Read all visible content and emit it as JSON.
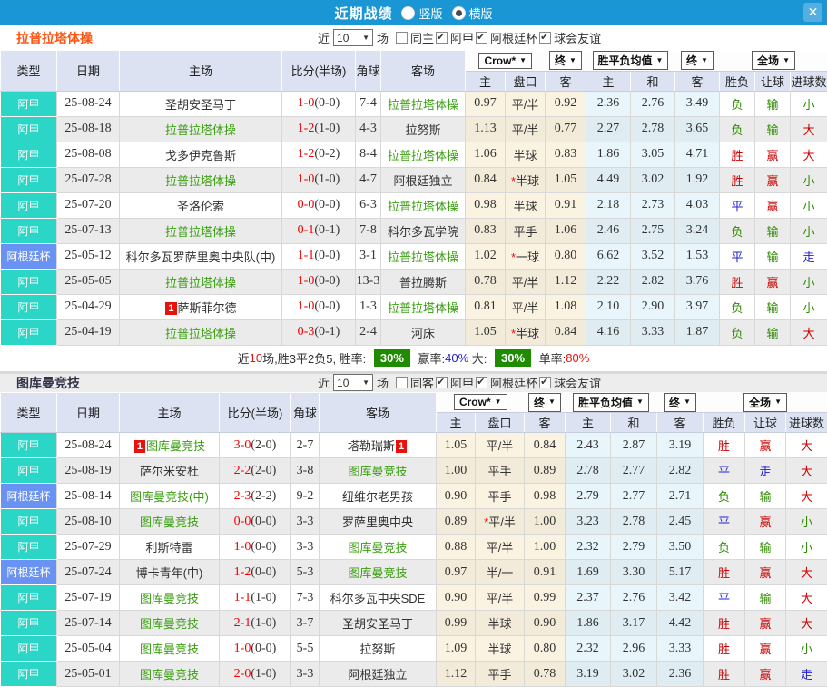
{
  "titlebar": {
    "title": "近期战绩",
    "vertical_label": "竖版",
    "vertical_checked": false,
    "horizontal_label": "横版",
    "horizontal_checked": true,
    "close_glyph": "✕"
  },
  "glyphs": {
    "down_arrow": "▼"
  },
  "colors": {
    "titlebar_bg": "#1b96d5",
    "section1_title": "#ff5412",
    "section2_title": "#323248",
    "league_badge_bg": "#2bd6c6",
    "cup_badge_bg": "#6a92f2",
    "self_team_green": "#3aa010",
    "score_red": "#f00000",
    "win_red": "#cc0000",
    "draw_blue": "#2222cc",
    "lose_green": "#2f8a00",
    "rate_badge_green": "#1f8c00"
  },
  "sections": [
    {
      "team": "拉普拉塔体操",
      "filter": {
        "near_label": "近",
        "games_value": "10",
        "games_suffix": "场",
        "same_label": "同主",
        "same_checked": false,
        "leagues": [
          {
            "label": "阿甲",
            "checked": true
          },
          {
            "label": "阿根廷杯",
            "checked": true
          },
          {
            "label": "球会友谊",
            "checked": true
          }
        ]
      },
      "header": {
        "type": "类型",
        "date": "日期",
        "home": "主场",
        "score": "比分(半场)",
        "corner": "角球",
        "away": "客场",
        "company_dd": "Crow*",
        "final_dd": "终",
        "avg_dd": "胜平负均值",
        "final_dd2": "终",
        "full_dd": "全场",
        "sub": {
          "home": "主",
          "handicap": "盘口",
          "away": "客",
          "avg_home": "主",
          "avg_draw": "和",
          "avg_away": "客",
          "wdl": "胜负",
          "hcap": "让球",
          "goals": "进球数"
        }
      },
      "rows": [
        {
          "type": "阿甲",
          "kind": "league",
          "date": "25-08-24",
          "home": "圣胡安圣马丁",
          "home_self": false,
          "home_badge": "",
          "score": "1-0",
          "half": "(0-0)",
          "corner": "7-4",
          "away": "拉普拉塔体操",
          "away_self": true,
          "away_badge": "",
          "o1": "0.97",
          "hcap": "平/半",
          "o2": "0.92",
          "a1": "2.36",
          "a2": "2.76",
          "a3": "3.49",
          "wdl": "负",
          "hres": "输",
          "goals": "小"
        },
        {
          "type": "阿甲",
          "kind": "league",
          "date": "25-08-18",
          "home": "拉普拉塔体操",
          "home_self": true,
          "home_badge": "",
          "score": "1-2",
          "half": "(1-0)",
          "corner": "4-3",
          "away": "拉努斯",
          "away_self": false,
          "away_badge": "",
          "o1": "1.13",
          "hcap": "平/半",
          "o2": "0.77",
          "a1": "2.27",
          "a2": "2.78",
          "a3": "3.65",
          "wdl": "负",
          "hres": "输",
          "goals": "大"
        },
        {
          "type": "阿甲",
          "kind": "league",
          "date": "25-08-08",
          "home": "戈多伊克鲁斯",
          "home_self": false,
          "home_badge": "",
          "score": "1-2",
          "half": "(0-2)",
          "corner": "8-4",
          "away": "拉普拉塔体操",
          "away_self": true,
          "away_badge": "",
          "o1": "1.06",
          "hcap": "半球",
          "o2": "0.83",
          "a1": "1.86",
          "a2": "3.05",
          "a3": "4.71",
          "wdl": "胜",
          "hres": "赢",
          "goals": "大"
        },
        {
          "type": "阿甲",
          "kind": "league",
          "date": "25-07-28",
          "home": "拉普拉塔体操",
          "home_self": true,
          "home_badge": "",
          "score": "1-0",
          "half": "(1-0)",
          "corner": "4-7",
          "away": "阿根廷独立",
          "away_self": false,
          "away_badge": "",
          "o1": "0.84",
          "hcap": "*半球",
          "o2": "1.05",
          "a1": "4.49",
          "a2": "3.02",
          "a3": "1.92",
          "wdl": "胜",
          "hres": "赢",
          "goals": "小"
        },
        {
          "type": "阿甲",
          "kind": "league",
          "date": "25-07-20",
          "home": "圣洛伦索",
          "home_self": false,
          "home_badge": "",
          "score": "0-0",
          "half": "(0-0)",
          "corner": "6-3",
          "away": "拉普拉塔体操",
          "away_self": true,
          "away_badge": "",
          "o1": "0.98",
          "hcap": "半球",
          "o2": "0.91",
          "a1": "2.18",
          "a2": "2.73",
          "a3": "4.03",
          "wdl": "平",
          "hres": "赢",
          "goals": "小"
        },
        {
          "type": "阿甲",
          "kind": "league",
          "date": "25-07-13",
          "home": "拉普拉塔体操",
          "home_self": true,
          "home_badge": "",
          "score": "0-1",
          "half": "(0-1)",
          "corner": "7-8",
          "away": "科尔多瓦学院",
          "away_self": false,
          "away_badge": "",
          "o1": "0.83",
          "hcap": "平手",
          "o2": "1.06",
          "a1": "2.46",
          "a2": "2.75",
          "a3": "3.24",
          "wdl": "负",
          "hres": "输",
          "goals": "小"
        },
        {
          "type": "阿根廷杯",
          "kind": "cup",
          "date": "25-05-12",
          "home": "科尔多瓦罗萨里奥中央队(中)",
          "home_self": false,
          "home_badge": "",
          "score": "1-1",
          "half": "(0-0)",
          "corner": "3-1",
          "away": "拉普拉塔体操",
          "away_self": true,
          "away_badge": "",
          "o1": "1.02",
          "hcap": "*一球",
          "o2": "0.80",
          "a1": "6.62",
          "a2": "3.52",
          "a3": "1.53",
          "wdl": "平",
          "hres": "输",
          "goals": "走"
        },
        {
          "type": "阿甲",
          "kind": "league",
          "date": "25-05-05",
          "home": "拉普拉塔体操",
          "home_self": true,
          "home_badge": "",
          "score": "1-0",
          "half": "(0-0)",
          "corner": "13-3",
          "away": "普拉腾斯",
          "away_self": false,
          "away_badge": "",
          "o1": "0.78",
          "hcap": "平/半",
          "o2": "1.12",
          "a1": "2.22",
          "a2": "2.82",
          "a3": "3.76",
          "wdl": "胜",
          "hres": "赢",
          "goals": "小"
        },
        {
          "type": "阿甲",
          "kind": "league",
          "date": "25-04-29",
          "home": "萨斯菲尔德",
          "home_self": false,
          "home_badge": "1",
          "score": "1-0",
          "half": "(0-0)",
          "corner": "1-3",
          "away": "拉普拉塔体操",
          "away_self": true,
          "away_badge": "",
          "o1": "0.81",
          "hcap": "平/半",
          "o2": "1.08",
          "a1": "2.10",
          "a2": "2.90",
          "a3": "3.97",
          "wdl": "负",
          "hres": "输",
          "goals": "小"
        },
        {
          "type": "阿甲",
          "kind": "league",
          "date": "25-04-19",
          "home": "拉普拉塔体操",
          "home_self": true,
          "home_badge": "",
          "score": "0-3",
          "half": "(0-1)",
          "corner": "2-4",
          "away": "河床",
          "away_self": false,
          "away_badge": "",
          "o1": "1.05",
          "hcap": "*半球",
          "o2": "0.84",
          "a1": "4.16",
          "a2": "3.33",
          "a3": "1.87",
          "wdl": "负",
          "hres": "输",
          "goals": "大"
        }
      ],
      "summary": [
        {
          "t": "近",
          "c": "k"
        },
        {
          "t": "10",
          "c": "r"
        },
        {
          "t": "场,胜3平2负5, 胜率: ",
          "c": "k"
        },
        {
          "t": "30%",
          "c": "G"
        },
        {
          "t": " 赢率:",
          "c": "k"
        },
        {
          "t": "40%",
          "c": "b"
        },
        {
          "t": " 大: ",
          "c": "k"
        },
        {
          "t": "30%",
          "c": "G"
        },
        {
          "t": " 单率:",
          "c": "k"
        },
        {
          "t": "80%",
          "c": "r"
        }
      ]
    },
    {
      "team": "图库曼竞技",
      "filter": {
        "near_label": "近",
        "games_value": "10",
        "games_suffix": "场",
        "same_label": "同客",
        "same_checked": false,
        "leagues": [
          {
            "label": "阿甲",
            "checked": true
          },
          {
            "label": "阿根廷杯",
            "checked": true
          },
          {
            "label": "球会友谊",
            "checked": true
          }
        ]
      },
      "header": {
        "type": "类型",
        "date": "日期",
        "home": "主场",
        "score": "比分(半场)",
        "corner": "角球",
        "away": "客场",
        "company_dd": "Crow*",
        "final_dd": "终",
        "avg_dd": "胜平负均值",
        "final_dd2": "终",
        "full_dd": "全场",
        "sub": {
          "home": "主",
          "handicap": "盘口",
          "away": "客",
          "avg_home": "主",
          "avg_draw": "和",
          "avg_away": "客",
          "wdl": "胜负",
          "hcap": "让球",
          "goals": "进球数"
        }
      },
      "rows": [
        {
          "type": "阿甲",
          "kind": "league",
          "date": "25-08-24",
          "home": "图库曼竞技",
          "home_self": true,
          "home_badge": "1",
          "score": "3-0",
          "half": "(2-0)",
          "corner": "2-7",
          "away": "塔勒瑞斯",
          "away_self": false,
          "away_badge": "1",
          "o1": "1.05",
          "hcap": "平/半",
          "o2": "0.84",
          "a1": "2.43",
          "a2": "2.87",
          "a3": "3.19",
          "wdl": "胜",
          "hres": "赢",
          "goals": "大"
        },
        {
          "type": "阿甲",
          "kind": "league",
          "date": "25-08-19",
          "home": "萨尔米安杜",
          "home_self": false,
          "home_badge": "",
          "score": "2-2",
          "half": "(2-0)",
          "corner": "3-8",
          "away": "图库曼竞技",
          "away_self": true,
          "away_badge": "",
          "o1": "1.00",
          "hcap": "平手",
          "o2": "0.89",
          "a1": "2.78",
          "a2": "2.77",
          "a3": "2.82",
          "wdl": "平",
          "hres": "走",
          "goals": "大"
        },
        {
          "type": "阿根廷杯",
          "kind": "cup",
          "date": "25-08-14",
          "home": "图库曼竞技(中)",
          "home_self": true,
          "home_badge": "",
          "score": "2-3",
          "half": "(2-2)",
          "corner": "9-2",
          "away": "纽维尔老男孩",
          "away_self": false,
          "away_badge": "",
          "o1": "0.90",
          "hcap": "平手",
          "o2": "0.98",
          "a1": "2.79",
          "a2": "2.77",
          "a3": "2.71",
          "wdl": "负",
          "hres": "输",
          "goals": "大"
        },
        {
          "type": "阿甲",
          "kind": "league",
          "date": "25-08-10",
          "home": "图库曼竞技",
          "home_self": true,
          "home_badge": "",
          "score": "0-0",
          "half": "(0-0)",
          "corner": "3-3",
          "away": "罗萨里奥中央",
          "away_self": false,
          "away_badge": "",
          "o1": "0.89",
          "hcap": "*平/半",
          "o2": "1.00",
          "a1": "3.23",
          "a2": "2.78",
          "a3": "2.45",
          "wdl": "平",
          "hres": "赢",
          "goals": "小"
        },
        {
          "type": "阿甲",
          "kind": "league",
          "date": "25-07-29",
          "home": "利斯特雷",
          "home_self": false,
          "home_badge": "",
          "score": "1-0",
          "half": "(0-0)",
          "corner": "3-3",
          "away": "图库曼竞技",
          "away_self": true,
          "away_badge": "",
          "o1": "0.88",
          "hcap": "平/半",
          "o2": "1.00",
          "a1": "2.32",
          "a2": "2.79",
          "a3": "3.50",
          "wdl": "负",
          "hres": "输",
          "goals": "小"
        },
        {
          "type": "阿根廷杯",
          "kind": "cup",
          "date": "25-07-24",
          "home": "博卡青年(中)",
          "home_self": false,
          "home_badge": "",
          "score": "1-2",
          "half": "(0-0)",
          "corner": "5-3",
          "away": "图库曼竞技",
          "away_self": true,
          "away_badge": "",
          "o1": "0.97",
          "hcap": "半/一",
          "o2": "0.91",
          "a1": "1.69",
          "a2": "3.30",
          "a3": "5.17",
          "wdl": "胜",
          "hres": "赢",
          "goals": "大"
        },
        {
          "type": "阿甲",
          "kind": "league",
          "date": "25-07-19",
          "home": "图库曼竞技",
          "home_self": true,
          "home_badge": "",
          "score": "1-1",
          "half": "(1-0)",
          "corner": "7-3",
          "away": "科尔多瓦中央SDE",
          "away_self": false,
          "away_badge": "",
          "o1": "0.90",
          "hcap": "平/半",
          "o2": "0.99",
          "a1": "2.37",
          "a2": "2.76",
          "a3": "3.42",
          "wdl": "平",
          "hres": "输",
          "goals": "大"
        },
        {
          "type": "阿甲",
          "kind": "league",
          "date": "25-07-14",
          "home": "图库曼竞技",
          "home_self": true,
          "home_badge": "",
          "score": "2-1",
          "half": "(1-0)",
          "corner": "3-7",
          "away": "圣胡安圣马丁",
          "away_self": false,
          "away_badge": "",
          "o1": "0.99",
          "hcap": "半球",
          "o2": "0.90",
          "a1": "1.86",
          "a2": "3.17",
          "a3": "4.42",
          "wdl": "胜",
          "hres": "赢",
          "goals": "大"
        },
        {
          "type": "阿甲",
          "kind": "league",
          "date": "25-05-04",
          "home": "图库曼竞技",
          "home_self": true,
          "home_badge": "",
          "score": "1-0",
          "half": "(0-0)",
          "corner": "5-5",
          "away": "拉努斯",
          "away_self": false,
          "away_badge": "",
          "o1": "1.09",
          "hcap": "半球",
          "o2": "0.80",
          "a1": "2.32",
          "a2": "2.96",
          "a3": "3.33",
          "wdl": "胜",
          "hres": "赢",
          "goals": "小"
        },
        {
          "type": "阿甲",
          "kind": "league",
          "date": "25-05-01",
          "home": "图库曼竞技",
          "home_self": true,
          "home_badge": "",
          "score": "2-0",
          "half": "(1-0)",
          "corner": "3-3",
          "away": "阿根廷独立",
          "away_self": false,
          "away_badge": "",
          "o1": "1.12",
          "hcap": "平手",
          "o2": "0.78",
          "a1": "3.19",
          "a2": "3.02",
          "a3": "2.36",
          "wdl": "胜",
          "hres": "赢",
          "goals": "走"
        }
      ],
      "summary": []
    }
  ]
}
